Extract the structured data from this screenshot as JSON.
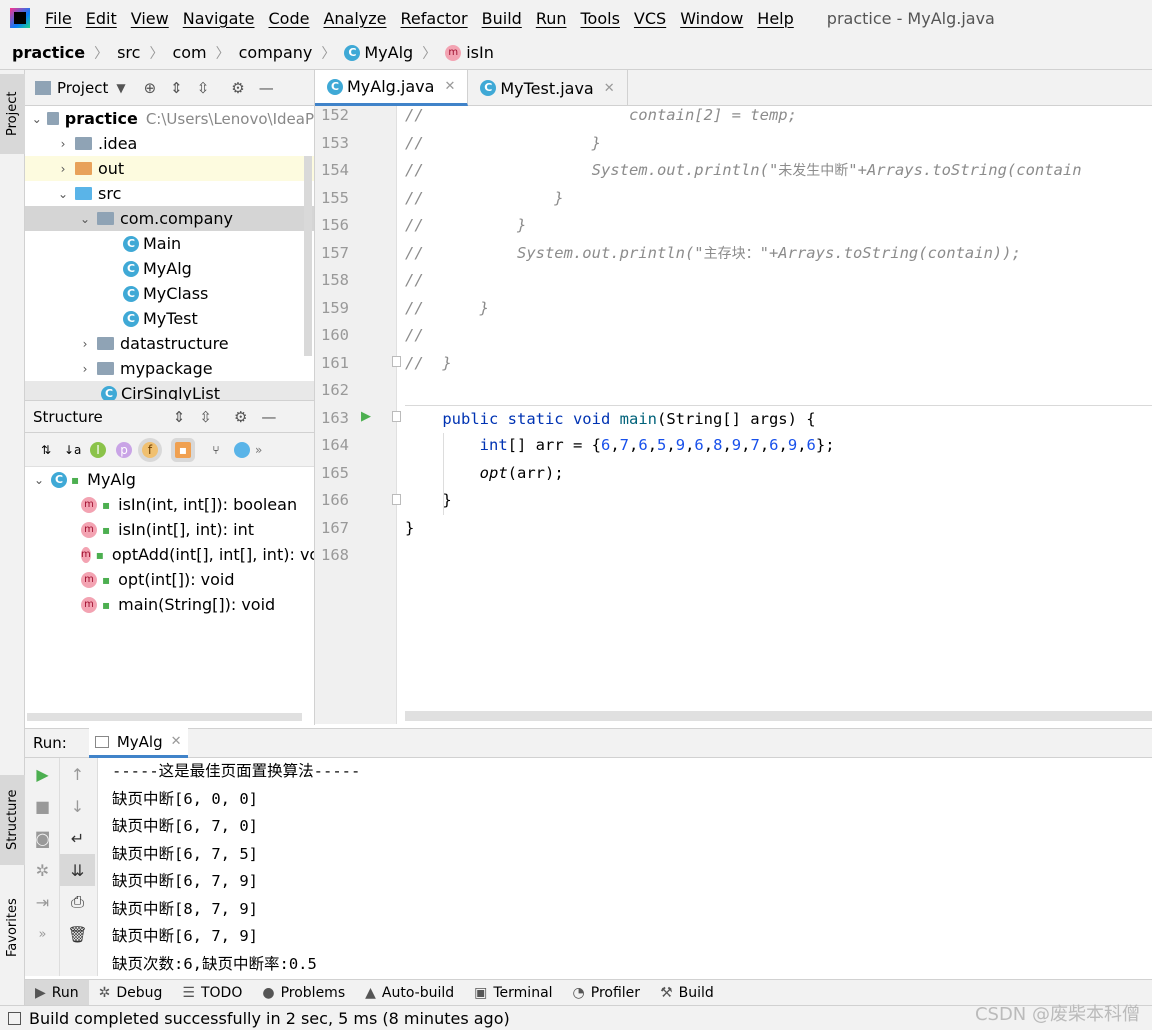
{
  "menubar": {
    "items": [
      "File",
      "Edit",
      "View",
      "Navigate",
      "Code",
      "Analyze",
      "Refactor",
      "Build",
      "Run",
      "Tools",
      "VCS",
      "Window",
      "Help"
    ],
    "window_title": "practice - MyAlg.java"
  },
  "breadcrumb": [
    "practice",
    "src",
    "com",
    "company",
    "MyAlg",
    "isIn"
  ],
  "sidebar_tabs": {
    "project": "Project",
    "structure": "Structure",
    "favorites": "Favorites"
  },
  "project": {
    "header": "Project",
    "root_name": "practice",
    "root_path": "C:\\Users\\Lenovo\\IdeaP",
    "items": [
      ".idea",
      "out",
      "src",
      "com.company",
      "Main",
      "MyAlg",
      "MyClass",
      "MyTest",
      "datastructure",
      "mypackage",
      "CirSinglyList"
    ]
  },
  "structure": {
    "header": "Structure",
    "class_name": "MyAlg",
    "members": [
      "isIn(int, int[]): boolean",
      "isIn(int[], int): int",
      "optAdd(int[], int[], int): void",
      "opt(int[]): void",
      "main(String[]): void"
    ]
  },
  "editor": {
    "tabs": [
      "MyAlg.java",
      "MyTest.java"
    ],
    "line_numbers": [
      "152",
      "153",
      "154",
      "155",
      "156",
      "157",
      "158",
      "159",
      "160",
      "161",
      "162",
      "163",
      "164",
      "165",
      "166",
      "167",
      "168"
    ],
    "code": {
      "l152": "//                      contain[2] = temp;",
      "l153": "//                  }",
      "l154a": "//                  System.out.println(\"",
      "l154b": "未发生中断",
      "l154c": "\"+Arrays.toString(contain",
      "l155": "//              }",
      "l156": "//          }",
      "l157a": "//          System.out.println(\"",
      "l157b": "主存块：",
      "l157c": "\"+Arrays.toString(contain));",
      "l158": "//",
      "l159": "//      }",
      "l160": "//",
      "l161": "//  }",
      "l163_kw": "public static void",
      "l163_fn": "main",
      "l163_rest": "(String[] args) {",
      "l164_kw": "int",
      "l164_mid": "[] arr = {",
      "l164_nums": [
        "6",
        "7",
        "6",
        "5",
        "9",
        "6",
        "8",
        "9",
        "7",
        "6",
        "9",
        "6"
      ],
      "l164_end": "};",
      "l165_fn": "opt",
      "l165_rest": "(arr);",
      "l166": "}",
      "l167": "}"
    }
  },
  "run": {
    "label": "Run:",
    "tab": "MyAlg",
    "output": [
      "-----这是最佳页面置换算法-----",
      "缺页中断[6, 0, 0]",
      "缺页中断[6, 7, 0]",
      "缺页中断[6, 7, 5]",
      "缺页中断[6, 7, 9]",
      "缺页中断[8, 7, 9]",
      "缺页中断[6, 7, 9]",
      "缺页次数:6,缺页中断率:0.5"
    ]
  },
  "bottom_tabs": [
    "Run",
    "Debug",
    "TODO",
    "Problems",
    "Auto-build",
    "Terminal",
    "Profiler",
    "Build"
  ],
  "status": "Build completed successfully in 2 sec, 5 ms (8 minutes ago)",
  "watermark": "CSDN @废柴本科僧"
}
